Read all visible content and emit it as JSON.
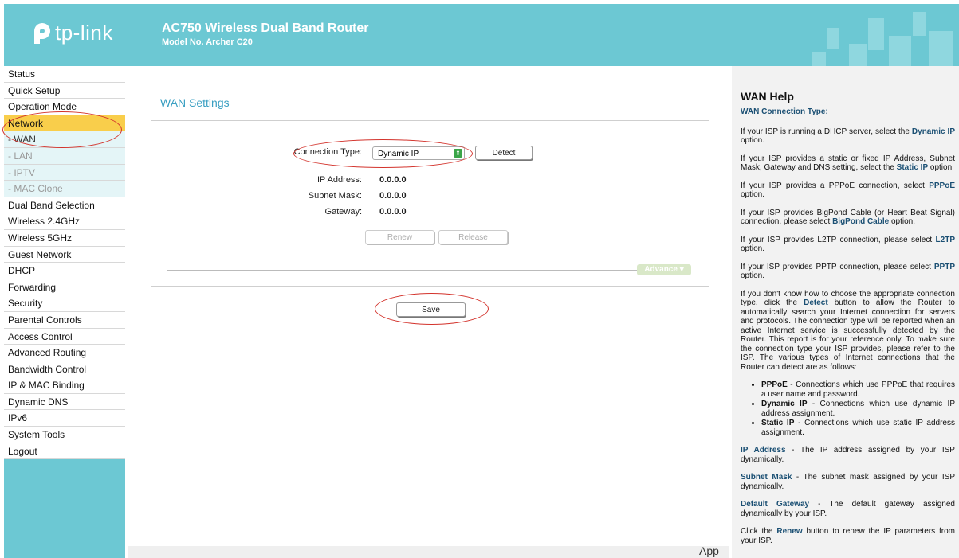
{
  "brand": {
    "name": "tp-link"
  },
  "header": {
    "title": "AC750 Wireless Dual Band Router",
    "model": "Model No. Archer C20"
  },
  "colors": {
    "teal": "#6cc8d3",
    "highlight": "#f9ce4b",
    "annotation": "#d3332c",
    "help_keyword": "#1a4f73"
  },
  "sidebar": {
    "items": [
      {
        "label": "Status"
      },
      {
        "label": "Quick Setup"
      },
      {
        "label": "Operation Mode"
      },
      {
        "label": "Network"
      },
      {
        "label": "- WAN"
      },
      {
        "label": "- LAN"
      },
      {
        "label": "- IPTV"
      },
      {
        "label": "- MAC Clone"
      },
      {
        "label": "Dual Band Selection"
      },
      {
        "label": "Wireless 2.4GHz"
      },
      {
        "label": "Wireless 5GHz"
      },
      {
        "label": "Guest Network"
      },
      {
        "label": "DHCP"
      },
      {
        "label": "Forwarding"
      },
      {
        "label": "Security"
      },
      {
        "label": "Parental Controls"
      },
      {
        "label": "Access Control"
      },
      {
        "label": "Advanced Routing"
      },
      {
        "label": "Bandwidth Control"
      },
      {
        "label": "IP & MAC Binding"
      },
      {
        "label": "Dynamic DNS"
      },
      {
        "label": "IPv6"
      },
      {
        "label": "System Tools"
      },
      {
        "label": "Logout"
      }
    ]
  },
  "main": {
    "title": "WAN Settings",
    "connection_type_label": "Connection Type:",
    "connection_type_value": "Dynamic IP",
    "detect_label": "Detect",
    "ip_label": "IP Address:",
    "ip_value": "0.0.0.0",
    "mask_label": "Subnet Mask:",
    "mask_value": "0.0.0.0",
    "gateway_label": "Gateway:",
    "gateway_value": "0.0.0.0",
    "renew_label": "Renew",
    "release_label": "Release",
    "advance_label": "Advance",
    "save_label": "Save",
    "app_link": "App"
  },
  "help": {
    "title": "WAN Help",
    "subtitle": "WAN Connection Type:",
    "p1a": "If your ISP is running a DHCP server, select the ",
    "p1k": "Dynamic IP",
    "p1b": " option.",
    "p2a": "If your ISP provides a static or fixed IP Address, Subnet Mask, Gateway and DNS setting, select the ",
    "p2k": "Static IP",
    "p2b": " option.",
    "p3a": "If your ISP provides a PPPoE connection, select ",
    "p3k": "PPPoE",
    "p3b": " option.",
    "p4a": "If your ISP provides BigPond Cable (or Heart Beat Signal) connection, please select ",
    "p4k": "BigPond Cable",
    "p4b": " option.",
    "p5a": "If your ISP provides L2TP connection, please select ",
    "p5k": "L2TP",
    "p5b": " option.",
    "p6a": "If your ISP provides PPTP connection, please select ",
    "p6k": "PPTP",
    "p6b": " option.",
    "p7a": "If you don't know how to choose the appropriate connection type, click the ",
    "p7k": "Detect",
    "p7b": " button to allow the Router to automatically search your Internet connection for servers and protocols. The connection type will be reported when an active Internet service is successfully detected by the Router. This report is for your reference only. To make sure the connection type your ISP provides, please refer to the ISP. The various types of Internet connections that the Router can detect are as follows:",
    "li1k": "PPPoE",
    "li1t": " - Connections which use PPPoE that requires a user name and password.",
    "li2k": "Dynamic IP",
    "li2t": " - Connections which use dynamic IP address assignment.",
    "li3k": "Static IP",
    "li3t": " - Connections which use static IP address assignment.",
    "p8k": "IP Address",
    "p8t": " - The IP address assigned by your ISP dynamically.",
    "p9k": "Subnet Mask",
    "p9t": " - The subnet mask assigned by your ISP dynamically.",
    "p10k": "Default Gateway",
    "p10t": " - The default gateway assigned dynamically by your ISP.",
    "p11a": "Click the ",
    "p11k": "Renew",
    "p11b": " button to renew the IP parameters from your ISP."
  }
}
